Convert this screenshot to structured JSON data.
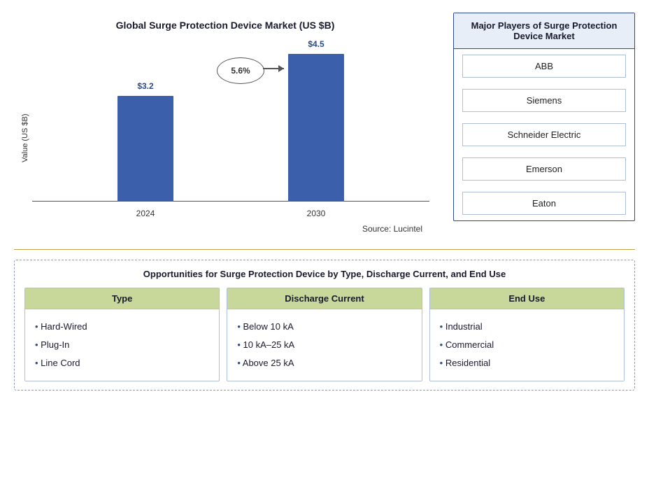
{
  "chart": {
    "title": "Global Surge Protection Device Market (US $B)",
    "y_axis_label": "Value (US $B)",
    "bars": [
      {
        "year": "2024",
        "value": "$3.2",
        "height_pct": 65
      },
      {
        "year": "2030",
        "value": "$4.5",
        "height_pct": 92
      }
    ],
    "cagr_label": "5.6%",
    "source_label": "Source: Lucintel"
  },
  "players": {
    "title": "Major Players of Surge Protection Device Market",
    "items": [
      {
        "name": "ABB"
      },
      {
        "name": "Siemens"
      },
      {
        "name": "Schneider Electric"
      },
      {
        "name": "Emerson"
      },
      {
        "name": "Eaton"
      }
    ]
  },
  "opportunities": {
    "title": "Opportunities for Surge Protection Device by Type, Discharge Current, and End Use",
    "columns": [
      {
        "header": "Type",
        "items": [
          "Hard-Wired",
          "Plug-In",
          "Line Cord"
        ]
      },
      {
        "header": "Discharge Current",
        "items": [
          "Below 10 kA",
          "10 kA–25 kA",
          "Above 25 kA"
        ]
      },
      {
        "header": "End Use",
        "items": [
          "Industrial",
          "Commercial",
          "Residential"
        ]
      }
    ]
  }
}
